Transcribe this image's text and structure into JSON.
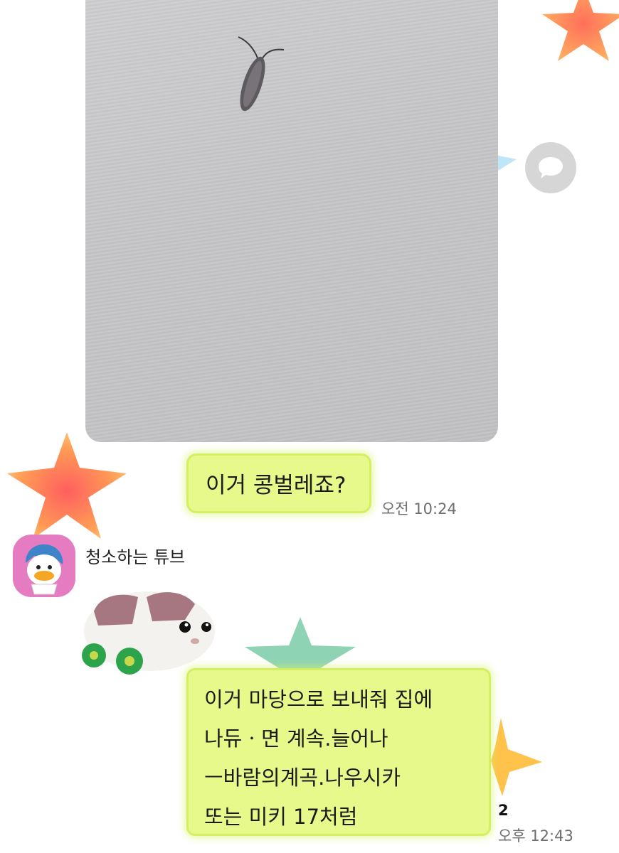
{
  "chat": {
    "messages": [
      {
        "type": "image",
        "image_alt": "photo of a small insect on a grey wall",
        "share_icon": "speech-bubble-icon"
      },
      {
        "type": "text",
        "text": "이거 콩벌레죠?",
        "time": "오전 10:24"
      },
      {
        "type": "text",
        "sender": "청소하는 튜브",
        "lines": [
          "이거 마당으로 보내줘 집에",
          "나듀ㆍ면 계속.늘어나",
          "ㅡ바람의계곡.나우시카",
          "또는 미키 17처럼"
        ],
        "unread_count": "2",
        "time": "오후 12:43"
      }
    ]
  },
  "colors": {
    "bubble": "#e6f98a",
    "bubble_border": "#d4ef63",
    "avatar_bg": "#e57bc1",
    "star_orange": "#ff8a4c",
    "star_teal": "#8fd3b5"
  }
}
